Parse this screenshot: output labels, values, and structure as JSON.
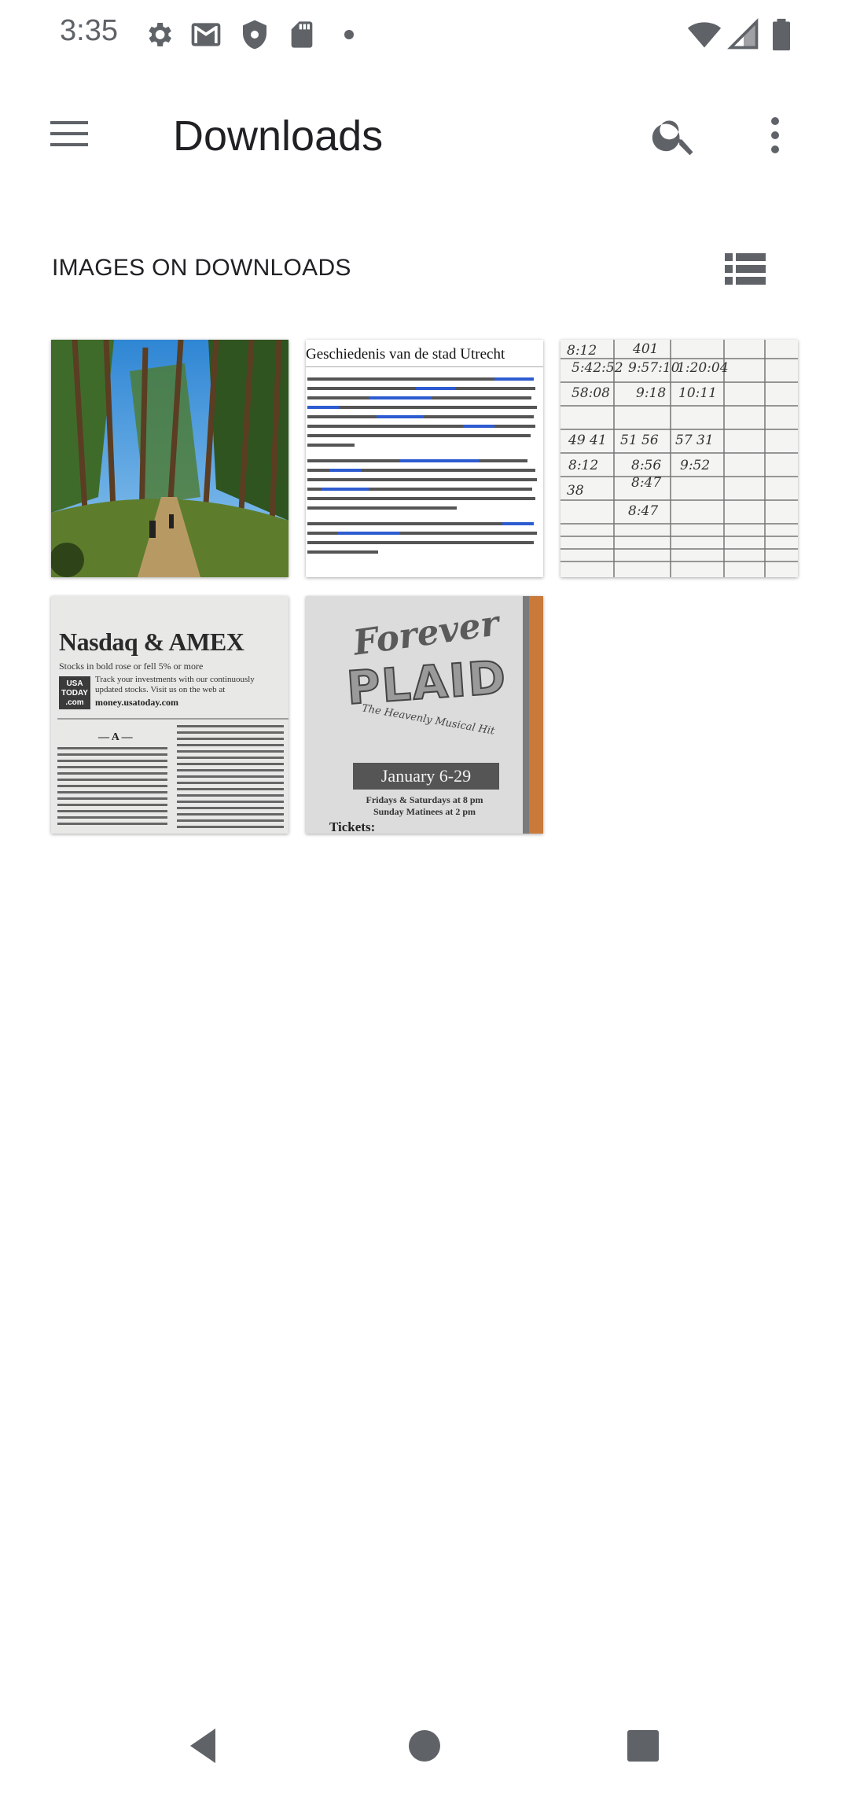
{
  "status_bar": {
    "time": "3:35",
    "left_icons": [
      "settings-icon",
      "gmail-icon",
      "shield-icon",
      "sd-card-icon",
      "dot-icon"
    ],
    "right_icons": [
      "wifi-icon",
      "signal-icon",
      "battery-icon"
    ]
  },
  "app_bar": {
    "title": "Downloads",
    "menu_icon": "hamburger-menu-icon",
    "search_icon": "search-icon",
    "more_icon": "more-vert-icon"
  },
  "section": {
    "title": "IMAGES ON DOWNLOADS",
    "view_toggle_icon": "list-view-icon"
  },
  "thumbnails": [
    {
      "name": "forest-photo",
      "texts": []
    },
    {
      "name": "utrecht-document",
      "texts": [
        "Geschiedenis van de stad Utrecht"
      ]
    },
    {
      "name": "handwritten-table",
      "texts": [
        "8:12",
        "401",
        "5:42:52",
        "9:57:10",
        "1:20:04",
        "58:08",
        "9:18",
        "10:11",
        "49 41",
        "51 56",
        "57 31",
        "8:12",
        "8:56",
        "9:52",
        "8:47",
        "38",
        "8:47"
      ]
    },
    {
      "name": "nasdaq-newspaper",
      "texts": [
        "Nasdaq & AMEX",
        "Stocks in bold rose or fell 5% or more",
        "USA TODAY .com",
        "Track your investments with our continuously updated stocks. Visit us on the web at",
        "money.usatoday.com",
        "— A —"
      ]
    },
    {
      "name": "forever-plaid-poster",
      "texts": [
        "Forever",
        "PLAID",
        "The Heavenly Musical Hit",
        "January 6-29",
        "Fridays & Saturdays at 8 pm",
        "Sunday Matinees at 2 pm",
        "Tickets:"
      ]
    }
  ],
  "nav_bar": {
    "back_icon": "back-icon",
    "home_icon": "home-icon",
    "recents_icon": "recents-icon"
  }
}
